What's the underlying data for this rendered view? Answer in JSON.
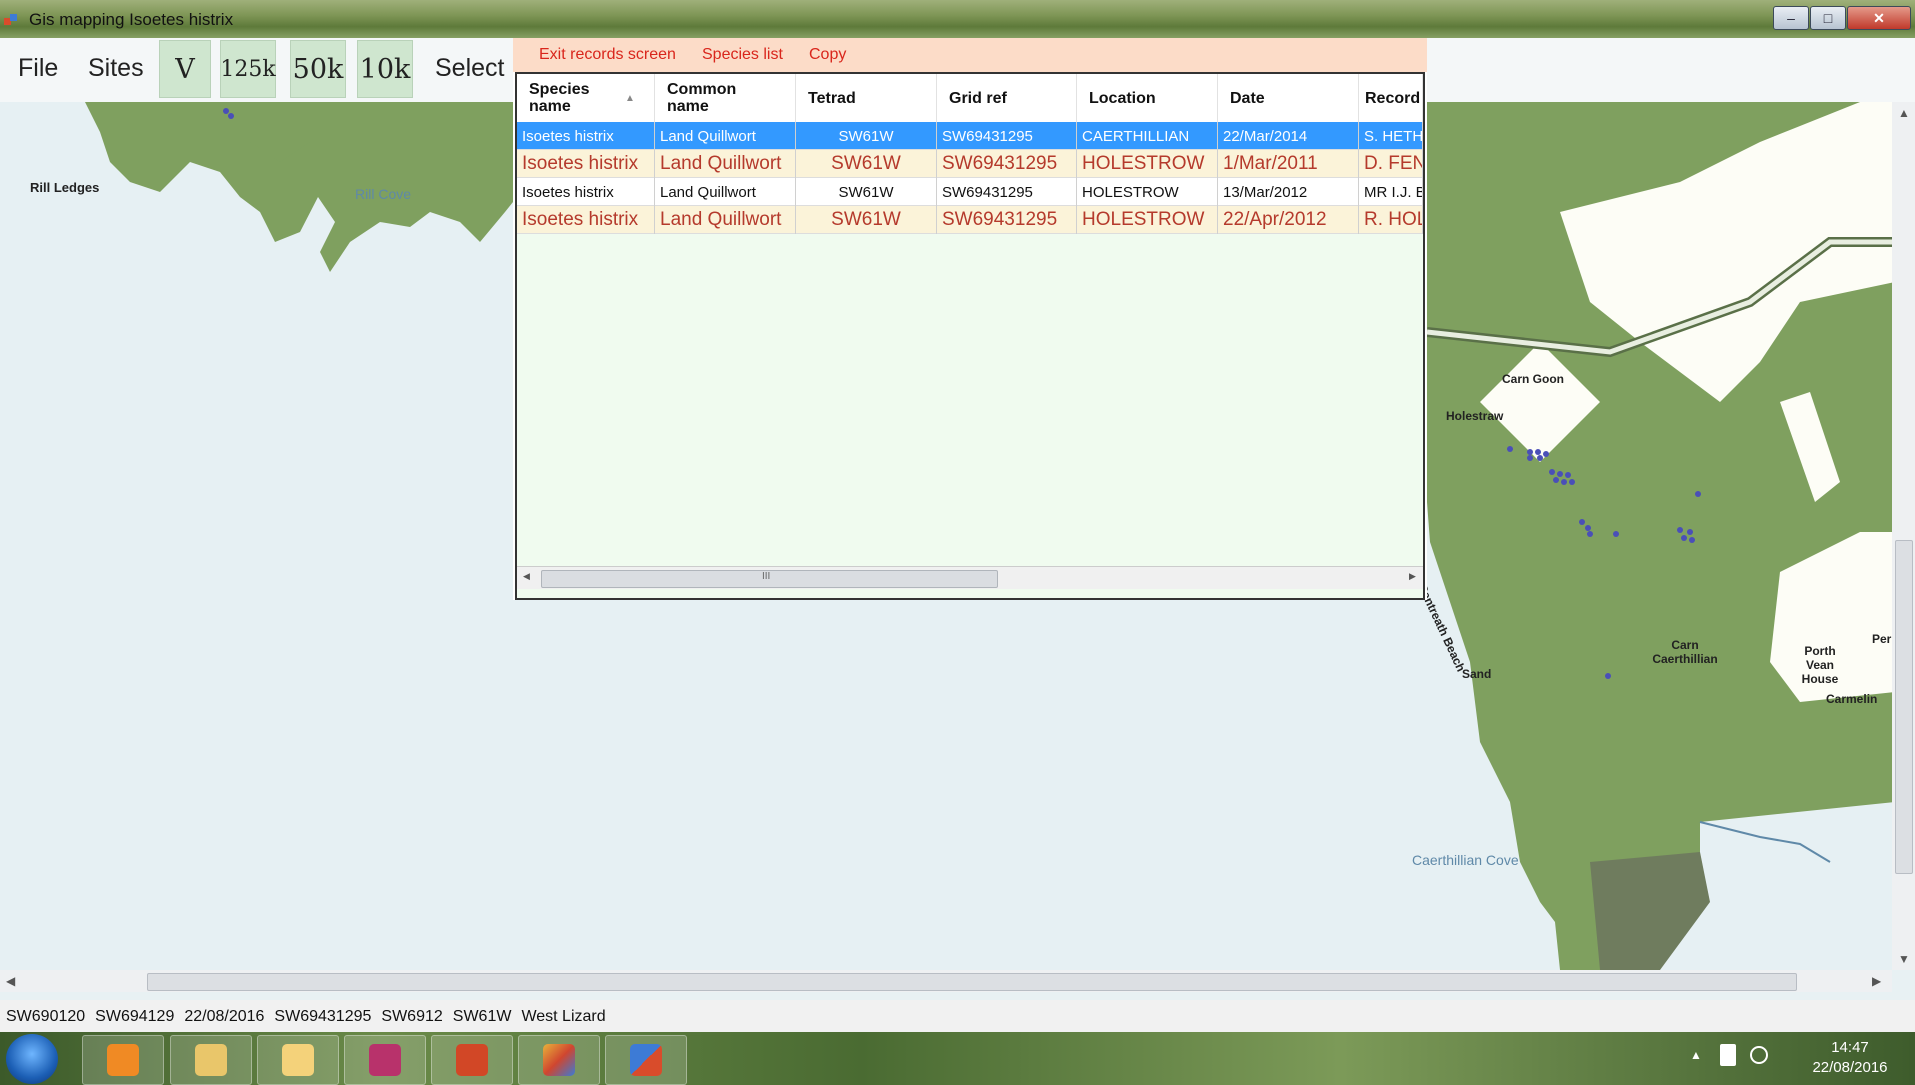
{
  "window": {
    "title": "Gis mapping Isoetes histrix",
    "minimize": "–",
    "maximize": "□",
    "close": "✕"
  },
  "menu": {
    "file": "File",
    "sites": "Sites",
    "select": "Select",
    "scales": [
      "V",
      "125k",
      "50k",
      "10k"
    ]
  },
  "records": {
    "menu": [
      "Exit records screen",
      "Species list",
      "Copy"
    ],
    "columns": [
      "Species name",
      "Common name",
      "Tetrad",
      "Grid ref",
      "Location",
      "Date",
      "Record"
    ],
    "rows": [
      {
        "species": "Isoetes histrix",
        "common": "Land Quillwort",
        "tetrad": "SW61W",
        "gridref": "SW69431295",
        "location": "CAERTHILLIAN",
        "date": "22/Mar/2014",
        "recorder": "S. HETH",
        "style": "selected"
      },
      {
        "species": "Isoetes histrix",
        "common": "Land Quillwort",
        "tetrad": "SW61W",
        "gridref": "SW69431295",
        "location": "HOLESTROW",
        "date": "1/Mar/2011",
        "recorder": "D. FEN",
        "style": "hl"
      },
      {
        "species": "Isoetes histrix",
        "common": "Land Quillwort",
        "tetrad": "SW61W",
        "gridref": "SW69431295",
        "location": "HOLESTROW",
        "date": "13/Mar/2012",
        "recorder": "MR I.J. B",
        "style": "plain"
      },
      {
        "species": "Isoetes histrix",
        "common": "Land Quillwort",
        "tetrad": "SW61W",
        "gridref": "SW69431295",
        "location": "HOLESTROW",
        "date": "22/Apr/2012",
        "recorder": "R. HOL",
        "style": "hl"
      }
    ],
    "scroll_glyph": "III"
  },
  "map": {
    "labels": {
      "rill_ledges": "Rill Ledges",
      "rill_cove": "Rill Cove",
      "carn_goon": "Carn Goon",
      "holestraw": "Holestraw",
      "pentreath_beach": "Pentreath Beach",
      "sand": "Sand",
      "carn_caerthillian": "Carn Caerthillian",
      "porth_vean_house": "Porth Vean House",
      "carmelin": "Carmelin",
      "per": "Per",
      "caerthillian_cove": "Caerthillian Cove"
    },
    "colors": {
      "land": "#7fa05f",
      "sea": "#e6f0f3",
      "white_area": "#fdfdf6",
      "dots": "#4a4fb8"
    }
  },
  "statusbar": {
    "items": [
      "SW690120",
      "SW694129",
      "22/08/2016",
      "SW69431295",
      "SW6912",
      "SW61W",
      "West Lizard"
    ]
  },
  "taskbar": {
    "time": "14:47",
    "date": "22/08/2016",
    "apps": [
      "media-player-icon",
      "file-explorer-icon",
      "outlook-icon",
      "access-icon",
      "powerpoint-icon",
      "paint-icon",
      "gis-app-icon"
    ]
  }
}
